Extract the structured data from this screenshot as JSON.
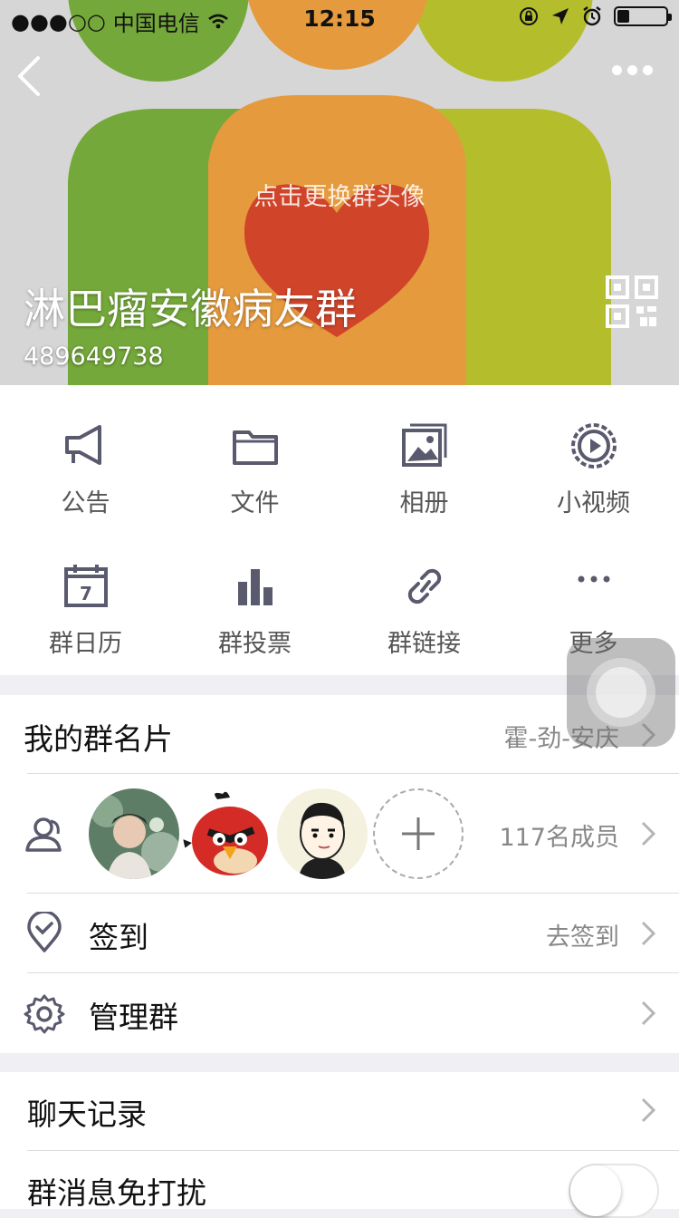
{
  "status_bar": {
    "signal": "●●●○○",
    "carrier": "中国电信",
    "time": "12:15",
    "battery_level": 0.25
  },
  "header": {
    "change_avatar_hint": "点击更换群头像",
    "group_name": "淋巴瘤安徽病友群",
    "group_id": "489649738"
  },
  "icons": {
    "back": "chevron-left-icon",
    "more": "more-dots-icon",
    "qr": "qr-code-icon"
  },
  "grid": {
    "announcement": "公告",
    "files": "文件",
    "album": "相册",
    "short_video": "小视频",
    "calendar": "群日历",
    "calendar_day": "7",
    "vote": "群投票",
    "link": "群链接",
    "more": "更多"
  },
  "my_card": {
    "title": "我的群名片",
    "value": "霍-劲-安庆"
  },
  "members": {
    "count_text": "117名成员"
  },
  "checkin": {
    "title": "签到",
    "value": "去签到"
  },
  "manage": {
    "title": "管理群"
  },
  "chat_history": {
    "title": "聊天记录"
  },
  "mute": {
    "title": "群消息免打扰",
    "enabled": false
  },
  "colors": {
    "icon_gray": "#5a5a6e",
    "accent_orange": "#e8963a",
    "accent_green": "#7aa83c",
    "accent_yellow": "#b9bf2e",
    "heart_red": "#d0452a"
  }
}
